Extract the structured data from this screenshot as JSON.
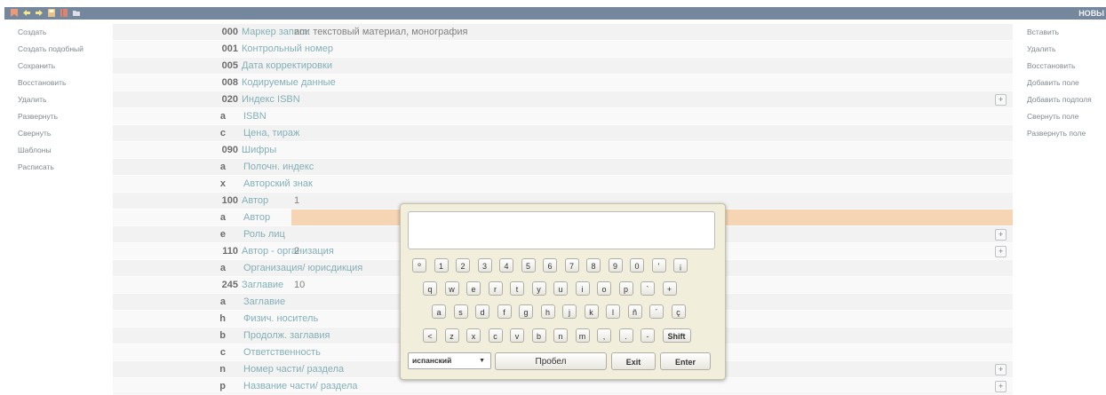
{
  "topbar": {
    "brand": "НОВЫ",
    "colors": {
      "bar": "#2c4868"
    }
  },
  "left_menu": [
    "Создать",
    "Создать подобный",
    "Сохранить",
    "Восстановить",
    "Удалить",
    "Развернуть",
    "Свернуть",
    "Шаблоны",
    "Расписать"
  ],
  "right_menu": [
    "Вставить",
    "Удалить",
    "Восстановить",
    "Добавить поле",
    "Добавить подполя",
    "Свернуть поле",
    "Развернуть поле"
  ],
  "rows": [
    {
      "code": "000",
      "name": "Маркер записи",
      "value": "am: текстовый материал, монография",
      "sub": false,
      "plus": false
    },
    {
      "code": "001",
      "name": "Контрольный номер",
      "value": "",
      "sub": false,
      "plus": false
    },
    {
      "code": "005",
      "name": "Дата корректировки",
      "value": "",
      "sub": false,
      "plus": false
    },
    {
      "code": "008",
      "name": "Кодируемые данные",
      "value": "",
      "sub": false,
      "plus": false
    },
    {
      "code": "020",
      "name": "Индекс ISBN",
      "value": "",
      "sub": false,
      "plus": true
    },
    {
      "code": "a",
      "name": "ISBN",
      "value": "",
      "sub": true,
      "plus": false
    },
    {
      "code": "c",
      "name": "Цена, тираж",
      "value": "",
      "sub": true,
      "plus": false
    },
    {
      "code": "090",
      "name": "Шифры",
      "value": "",
      "sub": false,
      "plus": false
    },
    {
      "code": "a",
      "name": "Полочн. индекс",
      "value": "",
      "sub": true,
      "plus": false
    },
    {
      "code": "x",
      "name": "Авторский знак",
      "value": "",
      "sub": true,
      "plus": false
    },
    {
      "code": "100",
      "name": "Автор",
      "value": "1",
      "sub": false,
      "plus": false
    },
    {
      "code": "a",
      "name": "Автор",
      "value": "",
      "sub": true,
      "plus": false,
      "highlight": true
    },
    {
      "code": "e",
      "name": "Роль лиц",
      "value": "",
      "sub": true,
      "plus": true
    },
    {
      "code": "110",
      "name": "Автор - организация",
      "value": "2",
      "sub": false,
      "plus": true
    },
    {
      "code": "a",
      "name": "Организация/ юрисдикция",
      "value": "",
      "sub": true,
      "plus": false
    },
    {
      "code": "245",
      "name": "Заглавие",
      "value": "10",
      "sub": false,
      "plus": false
    },
    {
      "code": "a",
      "name": "Заглавие",
      "value": "",
      "sub": true,
      "plus": false
    },
    {
      "code": "h",
      "name": "Физич. носитель",
      "value": "",
      "sub": true,
      "plus": false
    },
    {
      "code": "b",
      "name": "Продолж. заглавия",
      "value": "",
      "sub": true,
      "plus": false
    },
    {
      "code": "c",
      "name": "Ответственность",
      "value": "",
      "sub": true,
      "plus": false
    },
    {
      "code": "n",
      "name": "Номер части/ раздела",
      "value": "",
      "sub": true,
      "plus": true
    },
    {
      "code": "p",
      "name": "Название части/ раздела",
      "value": "",
      "sub": true,
      "plus": true
    }
  ],
  "plus_label": "+",
  "keyboard": {
    "input_value": "",
    "rows": [
      [
        "º",
        "1",
        "2",
        "3",
        "4",
        "5",
        "6",
        "7",
        "8",
        "9",
        "0",
        "'",
        "¡"
      ],
      [
        "q",
        "w",
        "e",
        "r",
        "t",
        "y",
        "u",
        "i",
        "o",
        "p",
        "`",
        "+"
      ],
      [
        "a",
        "s",
        "d",
        "f",
        "g",
        "h",
        "j",
        "k",
        "l",
        "ñ",
        "´",
        "ç"
      ],
      [
        "<",
        "z",
        "x",
        "c",
        "v",
        "b",
        "n",
        "m",
        ",",
        ".",
        "-",
        "Shift"
      ]
    ],
    "language": "испанский",
    "space_label": "Пробел",
    "exit_label": "Exit",
    "enter_label": "Enter"
  },
  "icons": [
    "bookmark-icon",
    "back-arrow-icon",
    "forward-arrow-icon",
    "save-icon",
    "book-icon",
    "folder-icon"
  ]
}
